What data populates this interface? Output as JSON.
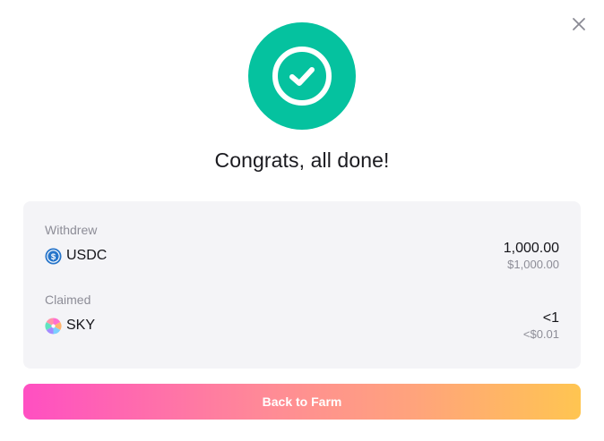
{
  "header": {
    "close_icon": "close-icon",
    "status_icon": "check-circle-icon",
    "status_color": "#05c29f",
    "title": "Congrats, all done!"
  },
  "summary": {
    "withdrew": {
      "label": "Withdrew",
      "token": "USDC",
      "token_icon": "usdc-icon",
      "amount": "1,000.00",
      "usd_value": "$1,000.00"
    },
    "claimed": {
      "label": "Claimed",
      "token": "SKY",
      "token_icon": "sky-icon",
      "amount": "<1",
      "usd_value": "<$0.01"
    }
  },
  "actions": {
    "back_label": "Back to Farm",
    "gradient_colors": [
      "#ff4fc2",
      "#ff8c95",
      "#ffa37c",
      "#ffc551"
    ]
  }
}
